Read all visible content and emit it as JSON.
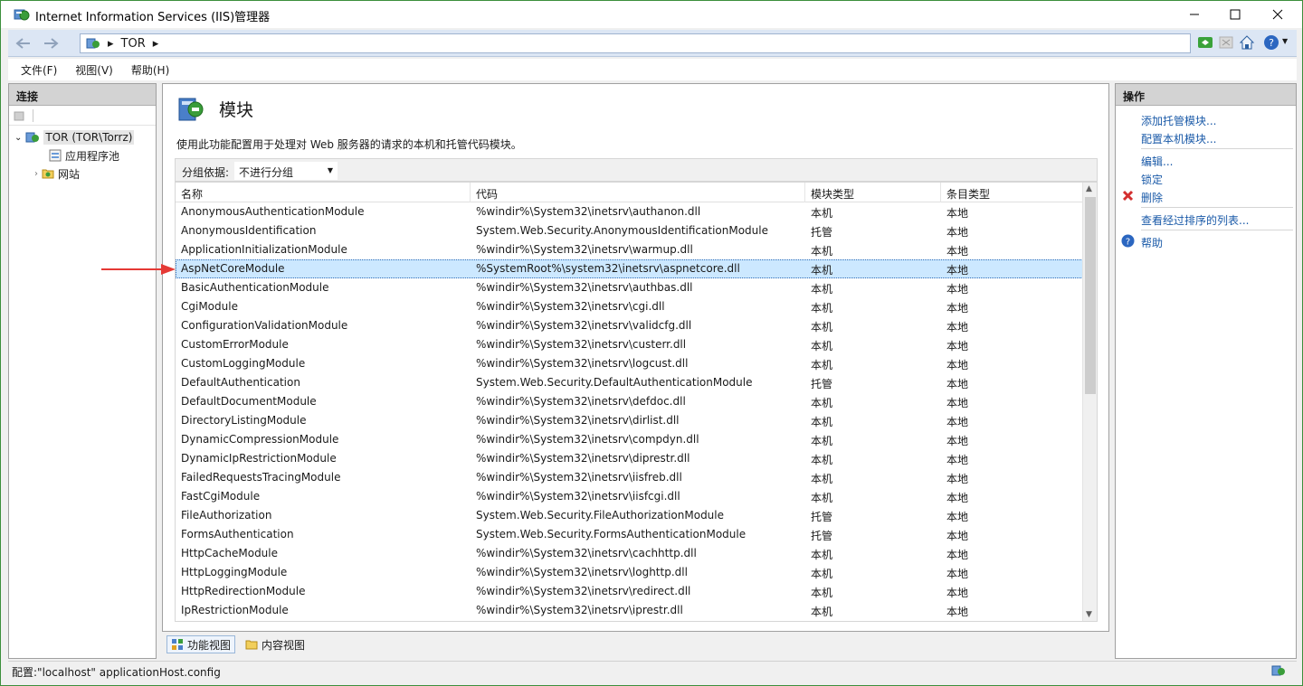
{
  "window": {
    "title": "Internet Information Services (IIS)管理器",
    "controls": {
      "minimize": "—",
      "maximize": "☐",
      "close": "✕"
    }
  },
  "address": {
    "crumbs": [
      "TOR"
    ],
    "separator": "▸"
  },
  "menu": {
    "items": [
      "文件(F)",
      "视图(V)",
      "帮助(H)"
    ]
  },
  "connections": {
    "header": "连接",
    "tree": {
      "server": "TOR (TOR\\Torrz)",
      "app_pools": "应用程序池",
      "sites": "网站"
    }
  },
  "module_page": {
    "title": "模块",
    "description": "使用此功能配置用于处理对 Web 服务器的请求的本机和托管代码模块。",
    "group_label": "分组依据:",
    "group_value": "不进行分组",
    "columns": [
      "名称",
      "代码",
      "模块类型",
      "条目类型"
    ],
    "rows": [
      {
        "name": "AnonymousAuthenticationModule",
        "code": "%windir%\\System32\\inetsrv\\authanon.dll",
        "type": "本机",
        "entry": "本地"
      },
      {
        "name": "AnonymousIdentification",
        "code": "System.Web.Security.AnonymousIdentificationModule",
        "type": "托管",
        "entry": "本地"
      },
      {
        "name": "ApplicationInitializationModule",
        "code": "%windir%\\System32\\inetsrv\\warmup.dll",
        "type": "本机",
        "entry": "本地"
      },
      {
        "name": "AspNetCoreModule",
        "code": "%SystemRoot%\\system32\\inetsrv\\aspnetcore.dll",
        "type": "本机",
        "entry": "本地"
      },
      {
        "name": "BasicAuthenticationModule",
        "code": "%windir%\\System32\\inetsrv\\authbas.dll",
        "type": "本机",
        "entry": "本地"
      },
      {
        "name": "CgiModule",
        "code": "%windir%\\System32\\inetsrv\\cgi.dll",
        "type": "本机",
        "entry": "本地"
      },
      {
        "name": "ConfigurationValidationModule",
        "code": "%windir%\\System32\\inetsrv\\validcfg.dll",
        "type": "本机",
        "entry": "本地"
      },
      {
        "name": "CustomErrorModule",
        "code": "%windir%\\System32\\inetsrv\\custerr.dll",
        "type": "本机",
        "entry": "本地"
      },
      {
        "name": "CustomLoggingModule",
        "code": "%windir%\\System32\\inetsrv\\logcust.dll",
        "type": "本机",
        "entry": "本地"
      },
      {
        "name": "DefaultAuthentication",
        "code": "System.Web.Security.DefaultAuthenticationModule",
        "type": "托管",
        "entry": "本地"
      },
      {
        "name": "DefaultDocumentModule",
        "code": "%windir%\\System32\\inetsrv\\defdoc.dll",
        "type": "本机",
        "entry": "本地"
      },
      {
        "name": "DirectoryListingModule",
        "code": "%windir%\\System32\\inetsrv\\dirlist.dll",
        "type": "本机",
        "entry": "本地"
      },
      {
        "name": "DynamicCompressionModule",
        "code": "%windir%\\System32\\inetsrv\\compdyn.dll",
        "type": "本机",
        "entry": "本地"
      },
      {
        "name": "DynamicIpRestrictionModule",
        "code": "%windir%\\System32\\inetsrv\\diprestr.dll",
        "type": "本机",
        "entry": "本地"
      },
      {
        "name": "FailedRequestsTracingModule",
        "code": "%windir%\\System32\\inetsrv\\iisfreb.dll",
        "type": "本机",
        "entry": "本地"
      },
      {
        "name": "FastCgiModule",
        "code": "%windir%\\System32\\inetsrv\\iisfcgi.dll",
        "type": "本机",
        "entry": "本地"
      },
      {
        "name": "FileAuthorization",
        "code": "System.Web.Security.FileAuthorizationModule",
        "type": "托管",
        "entry": "本地"
      },
      {
        "name": "FormsAuthentication",
        "code": "System.Web.Security.FormsAuthenticationModule",
        "type": "托管",
        "entry": "本地"
      },
      {
        "name": "HttpCacheModule",
        "code": "%windir%\\System32\\inetsrv\\cachhttp.dll",
        "type": "本机",
        "entry": "本地"
      },
      {
        "name": "HttpLoggingModule",
        "code": "%windir%\\System32\\inetsrv\\loghttp.dll",
        "type": "本机",
        "entry": "本地"
      },
      {
        "name": "HttpRedirectionModule",
        "code": "%windir%\\System32\\inetsrv\\redirect.dll",
        "type": "本机",
        "entry": "本地"
      },
      {
        "name": "IpRestrictionModule",
        "code": "%windir%\\System32\\inetsrv\\iprestr.dll",
        "type": "本机",
        "entry": "本地"
      }
    ],
    "selected_row": "AspNetCoreModule",
    "view_tabs": {
      "features": "功能视图",
      "content": "内容视图"
    }
  },
  "actions": {
    "header": "操作",
    "add_managed": "添加托管模块...",
    "configure_native": "配置本机模块...",
    "edit": "编辑...",
    "lock": "锁定",
    "delete": "删除",
    "view_ordered": "查看经过排序的列表...",
    "help": "帮助"
  },
  "status": {
    "text": "配置:\"localhost\" applicationHost.config"
  },
  "colors": {
    "selection": "#cce8ff",
    "link": "#1a5aa8",
    "arrow": "#e53935",
    "delete": "#d32f2f"
  }
}
